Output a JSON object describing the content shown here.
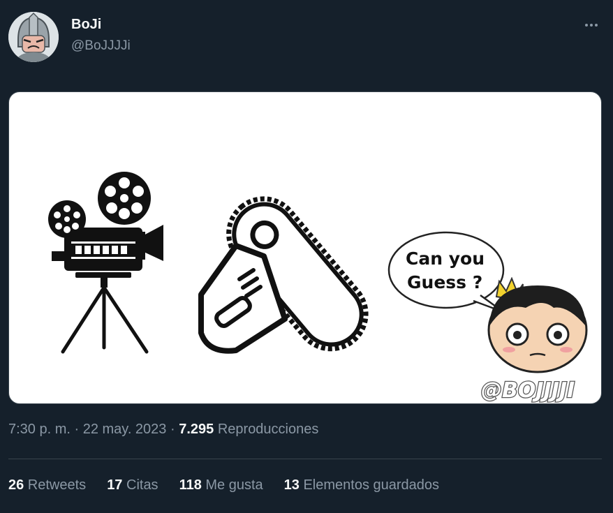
{
  "author": {
    "display_name": "BoJi",
    "handle": "@BoJJJJi",
    "avatar_icon": "helmeted-character-avatar"
  },
  "media": {
    "bubble_line1": "Can you",
    "bubble_line2": "Guess ?",
    "watermark": "@BOJJJJI",
    "icons": [
      "film-camera-icon",
      "chainsaw-icon",
      "crowned-boy-character"
    ]
  },
  "meta": {
    "time": "7:30 p. m.",
    "separator1": " · ",
    "date": "22 may. 2023",
    "separator2": " · ",
    "views_count": "7.295",
    "views_label": " Reproducciones"
  },
  "stats": {
    "retweets_count": "26",
    "retweets_label": " Retweets",
    "quotes_count": "17",
    "quotes_label": " Citas",
    "likes_count": "118",
    "likes_label": " Me gusta",
    "bookmarks_count": "13",
    "bookmarks_label": " Elementos guardados"
  },
  "colors": {
    "background": "#15202b",
    "text_primary": "#f7f9f9",
    "text_secondary": "#8b98a5",
    "divider": "#38444d"
  }
}
